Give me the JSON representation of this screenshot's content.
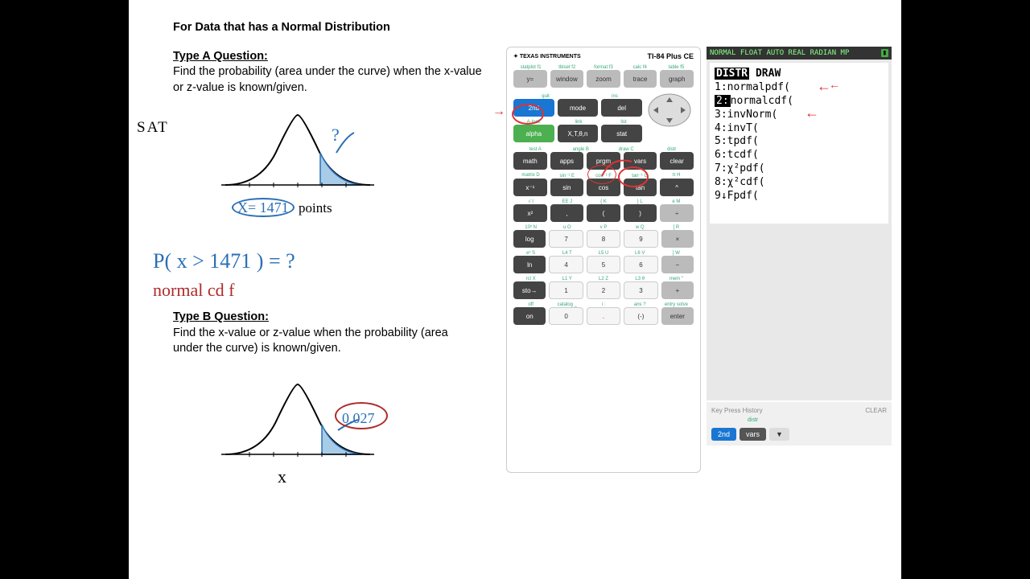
{
  "title": "For Data that has a Normal Distribution",
  "typeA": {
    "heading": "Type A Question:",
    "text": "Find the probability (area under the curve) when the x-value or z-value is known/given."
  },
  "typeB": {
    "heading": "Type B Question:",
    "text": "Find the x-value or z-value when the probability (area under the curve) is known/given."
  },
  "hand": {
    "sat": "SAT",
    "xval": "X= 1471",
    "pts": "points",
    "q": "?",
    "prob": "P( x > 1471 ) = ?",
    "ncdf": "normal cd f",
    "xlab": "x",
    "area": "0.027"
  },
  "calc": {
    "brand": "TEXAS INSTRUMENTS",
    "model": "TI-84 Plus CE",
    "row_labels_top": [
      "statplot f1",
      "tblset f2",
      "format f3",
      "calc f4",
      "table f5"
    ],
    "row1": [
      "y=",
      "window",
      "zoom",
      "trace",
      "graph"
    ],
    "row2_labels": [
      "quit",
      "ins"
    ],
    "row2": [
      "2nd",
      "mode",
      "del"
    ],
    "row3_labels": [
      "A-lock",
      "link",
      "list"
    ],
    "row3": [
      "alpha",
      "X,T,θ,n",
      "stat"
    ],
    "row4_labels": [
      "test A",
      "angle B",
      "draw C",
      "distr"
    ],
    "row4": [
      "math",
      "apps",
      "prgm",
      "vars",
      "clear"
    ],
    "row5_labels": [
      "matrix D",
      "sin⁻¹ E",
      "cos⁻¹ F",
      "tan⁻¹ G",
      "π H"
    ],
    "row5": [
      "x⁻¹",
      "sin",
      "cos",
      "tan",
      "^"
    ],
    "row6_labels": [
      "√ I",
      "EE J",
      "{ K",
      "} L",
      "e M"
    ],
    "row6": [
      "x²",
      ",",
      "(",
      ")",
      "÷"
    ],
    "row7_labels": [
      "10ˣ N",
      "u O",
      "v P",
      "w Q",
      "[ R"
    ],
    "row7": [
      "log",
      "7",
      "8",
      "9",
      "×"
    ],
    "row8_labels": [
      "eˣ S",
      "L4 T",
      "L5 U",
      "L6 V",
      "] W"
    ],
    "row8": [
      "ln",
      "4",
      "5",
      "6",
      "−"
    ],
    "row9_labels": [
      "rcl X",
      "L1 Y",
      "L2 Z",
      "L3 θ",
      "mem \""
    ],
    "row9": [
      "sto→",
      "1",
      "2",
      "3",
      "+"
    ],
    "row10_labels": [
      "off",
      "catalog _",
      "i :",
      "ans ?",
      "entry solve"
    ],
    "row10": [
      "on",
      "0",
      ".",
      "(-)",
      "enter"
    ]
  },
  "screen": {
    "status": "NORMAL FLOAT AUTO REAL RADIAN MP",
    "tab1": "DISTR",
    "tab2": "DRAW",
    "items": [
      "1:normalpdf(",
      "2:normalcdf(",
      "3:invNorm(",
      "4:invT(",
      "5:tpdf(",
      "6:tcdf(",
      "7:χ²pdf(",
      "8:χ²cdf(",
      "9↓Fpdf("
    ]
  },
  "kph": {
    "title": "Key Press History",
    "clear": "CLEAR",
    "label": "distr",
    "keys": [
      "2nd",
      "vars",
      "▼"
    ]
  }
}
